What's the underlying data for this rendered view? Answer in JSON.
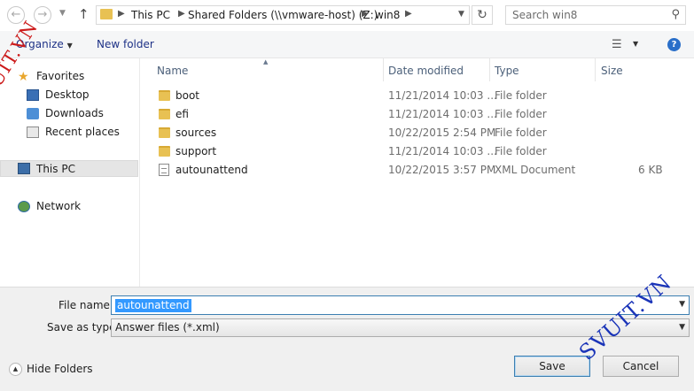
{
  "address_bar": {
    "breadcrumbs": [
      "This PC",
      "Shared Folders (\\\\vmware-host) (Z:)",
      "win8"
    ],
    "search_placeholder": "Search win8"
  },
  "toolbar": {
    "organize_label": "Organize",
    "new_folder_label": "New folder"
  },
  "nav": {
    "favorites": "Favorites",
    "desktop": "Desktop",
    "downloads": "Downloads",
    "recent_places": "Recent places",
    "this_pc": "This PC",
    "network": "Network"
  },
  "columns": {
    "name": "Name",
    "date_modified": "Date modified",
    "type": "Type",
    "size": "Size"
  },
  "files": [
    {
      "name": "boot",
      "date": "11/21/2014 10:03 ...",
      "type": "File folder",
      "size": ""
    },
    {
      "name": "efi",
      "date": "11/21/2014 10:03 ...",
      "type": "File folder",
      "size": ""
    },
    {
      "name": "sources",
      "date": "10/22/2015 2:54 PM",
      "type": "File folder",
      "size": ""
    },
    {
      "name": "support",
      "date": "11/21/2014 10:03 ...",
      "type": "File folder",
      "size": ""
    },
    {
      "name": "autounattend",
      "date": "10/22/2015 3:57 PM",
      "type": "XML Document",
      "size": "6 KB"
    }
  ],
  "form": {
    "file_name_label": "File name:",
    "file_name_value": "autounattend",
    "save_as_type_label": "Save as type:",
    "save_as_type_value": "Answer files (*.xml)"
  },
  "footer": {
    "hide_folders_label": "Hide Folders",
    "save_label": "Save",
    "cancel_label": "Cancel"
  },
  "watermark": {
    "text": "SVUIT.VN"
  },
  "colors": {
    "accent": "#3c7fb1",
    "selection": "#3399ff",
    "folder": "#e8c153",
    "watermark_red": "#cc1a1a",
    "watermark_blue": "#1a34b8"
  }
}
